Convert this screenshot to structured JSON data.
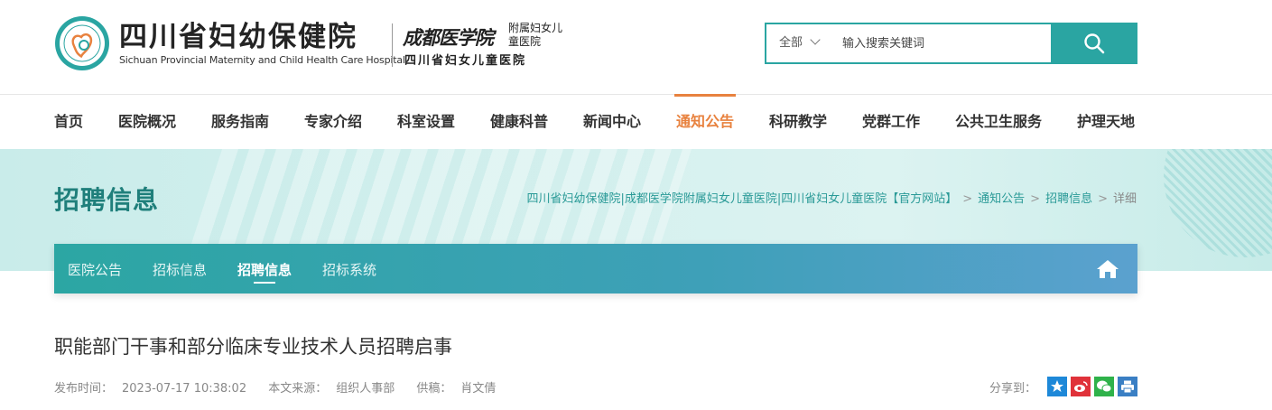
{
  "logo": {
    "name_cn": "四川省妇幼保健院",
    "name_en": "Sichuan Provincial Maternity and Child Health Care Hospital",
    "calligraphy": "成都医学院",
    "affiliation": "附属妇女儿童医院",
    "sub_name": "四川省妇女儿童医院"
  },
  "search": {
    "scope": "全部",
    "placeholder": "输入搜索关键词"
  },
  "nav": {
    "items": [
      "首页",
      "医院概况",
      "服务指南",
      "专家介绍",
      "科室设置",
      "健康科普",
      "新闻中心",
      "通知公告",
      "科研教学",
      "党群工作",
      "公共卫生服务",
      "护理天地"
    ],
    "active": "通知公告"
  },
  "banner": {
    "title": "招聘信息",
    "breadcrumb": [
      "四川省妇幼保健院|成都医学院附属妇女儿童医院|四川省妇女儿童医院【官方网站】",
      "通知公告",
      "招聘信息",
      "详细"
    ]
  },
  "subnav": {
    "items": [
      "医院公告",
      "招标信息",
      "招聘信息",
      "招标系统"
    ],
    "active": "招聘信息"
  },
  "article": {
    "title": "职能部门干事和部分临床专业技术人员招聘启事",
    "publish_label": "发布时间：",
    "publish_time": "2023-07-17 10:38:02",
    "source_label": "本文来源：",
    "source": "组织人事部",
    "author_label": "供稿：",
    "author": "肖文倩",
    "share_label": "分享到："
  },
  "colors": {
    "brand": "#2aa5a2",
    "accent": "#e8823f",
    "share_qzone": "#1e88d8",
    "share_weibo": "#e0323a",
    "share_wechat": "#2fb24a",
    "share_print": "#3a7fc4"
  },
  "icons": {
    "search": "search-icon",
    "home": "home-icon",
    "share": [
      "qzone-icon",
      "weibo-icon",
      "wechat-icon",
      "print-icon"
    ]
  }
}
